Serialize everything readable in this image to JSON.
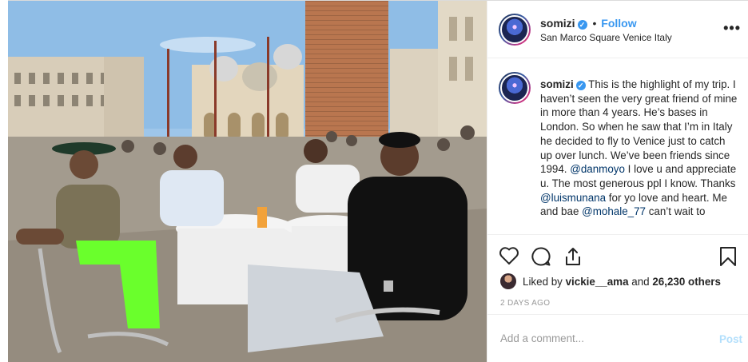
{
  "post": {
    "username": "somizi",
    "verified_glyph": "✓",
    "separator": "•",
    "follow_label": "Follow",
    "location": "San Marco Square Venice Italy",
    "more_glyph": "•••",
    "photo_icon": "photo-scene",
    "caption": {
      "username": "somizi",
      "part1": "This is the highlight of my trip. I haven’t seen the very great friend of mine in more than 4 years. He’s bases in London. So when he saw that I’m in Italy he decided to fly to Venice just to catch up over lunch. We’ve been friends since 1994.",
      "mention1": "@danmoyo",
      "part2": " I love u and appreciate u. The most generous ppl I know. Thanks ",
      "mention2": "@luismunana",
      "part3": " for yo love and heart. Me and bae ",
      "mention3": "@mohale_77",
      "part4": " can’t wait to"
    },
    "likes": {
      "prefix": "Liked by ",
      "user": "vickie__ama",
      "middle": " and ",
      "count": "26,230 others"
    },
    "date": "2 DAYS AGO",
    "comment": {
      "placeholder": "Add a comment...",
      "post_label": "Post"
    },
    "icons": [
      "heart-icon",
      "comment-icon",
      "share-icon",
      "bookmark-icon"
    ]
  }
}
